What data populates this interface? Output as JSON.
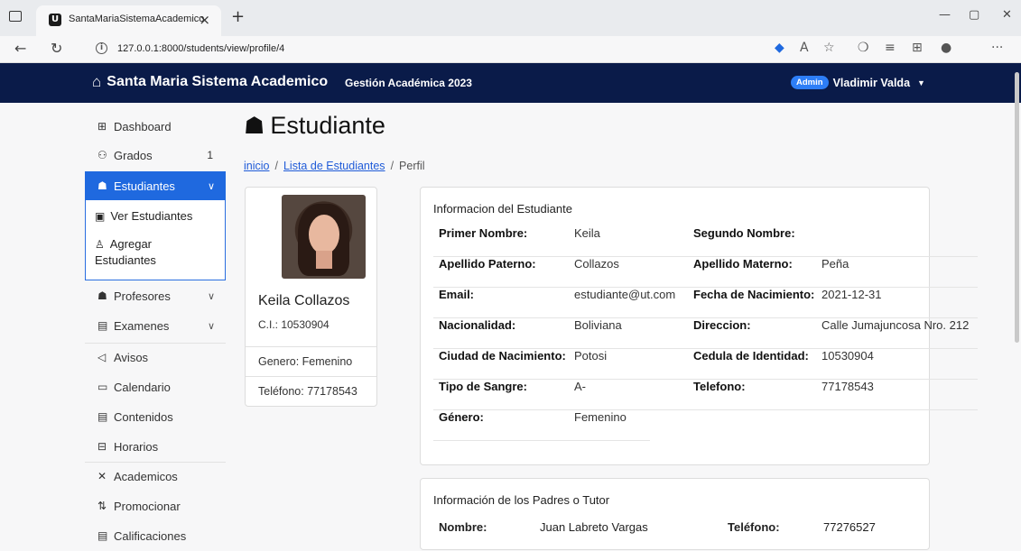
{
  "browser": {
    "tab_title": "SantaMariaSistemaAcademico",
    "url": "127.0.0.1:8000/students/view/profile/4"
  },
  "navbar": {
    "brand": "Santa Maria Sistema Academico",
    "session": "Gestión Académica 2023",
    "role_badge": "Admin",
    "user_name": "Vladimir Valda"
  },
  "sidebar": {
    "items": [
      {
        "label": "Dashboard",
        "icon": "grid-icon"
      },
      {
        "label": "Grados",
        "icon": "sitemap-icon",
        "count": "1"
      },
      {
        "label": "Estudiantes",
        "icon": "student-icon",
        "active": true
      },
      {
        "label": "Profesores",
        "icon": "teacher-icon"
      },
      {
        "label": "Examenes",
        "icon": "exam-icon"
      },
      {
        "label": "Avisos",
        "icon": "megaphone-icon"
      },
      {
        "label": "Calendario",
        "icon": "calendar-icon"
      },
      {
        "label": "Contenidos",
        "icon": "content-icon"
      },
      {
        "label": "Horarios",
        "icon": "schedule-icon"
      },
      {
        "label": "Academicos",
        "icon": "tools-icon"
      },
      {
        "label": "Promocionar",
        "icon": "promote-icon"
      },
      {
        "label": "Calificaciones",
        "icon": "grades-icon"
      }
    ],
    "submenu": [
      {
        "label": "Ver Estudiantes"
      },
      {
        "label": "Agregar Estudiantes"
      }
    ]
  },
  "page": {
    "title": "Estudiante",
    "breadcrumb": {
      "home": "inicio",
      "list": "Lista de Estudiantes",
      "current": "Perfil"
    }
  },
  "profile": {
    "name": "Keila Collazos",
    "ci": "C.I.: 10530904",
    "gender": "Genero: Femenino",
    "phone": "Teléfono: 77178543"
  },
  "student_info": {
    "header": "Informacion del Estudiante",
    "rows": [
      {
        "l1": "Primer Nombre:",
        "v1": "Keila",
        "l2": "Segundo Nombre:",
        "v2": ""
      },
      {
        "l1": "Apellido Paterno:",
        "v1": "Collazos",
        "l2": "Apellido Materno:",
        "v2": "Peña"
      },
      {
        "l1": "Email:",
        "v1": "estudiante@ut.com",
        "l2": "Fecha de Nacimiento:",
        "v2": "2021-12-31"
      },
      {
        "l1": "Nacionalidad:",
        "v1": "Boliviana",
        "l2": "Direccion:",
        "v2": "Calle Jumajuncosa Nro. 212"
      },
      {
        "l1": "Ciudad de Nacimiento:",
        "v1": "Potosi",
        "l2": "Cedula de Identidad:",
        "v2": "10530904"
      },
      {
        "l1": "Tipo de Sangre:",
        "v1": "A-",
        "l2": "Telefono:",
        "v2": "77178543"
      },
      {
        "l1": "Género:",
        "v1": "Femenino",
        "l2": "",
        "v2": ""
      }
    ]
  },
  "parents_info": {
    "header": "Información de los Padres o Tutor",
    "name_label": "Nombre:",
    "name_value": "Juan Labreto Vargas",
    "phone_label": "Teléfono:",
    "phone_value": "77276527"
  }
}
